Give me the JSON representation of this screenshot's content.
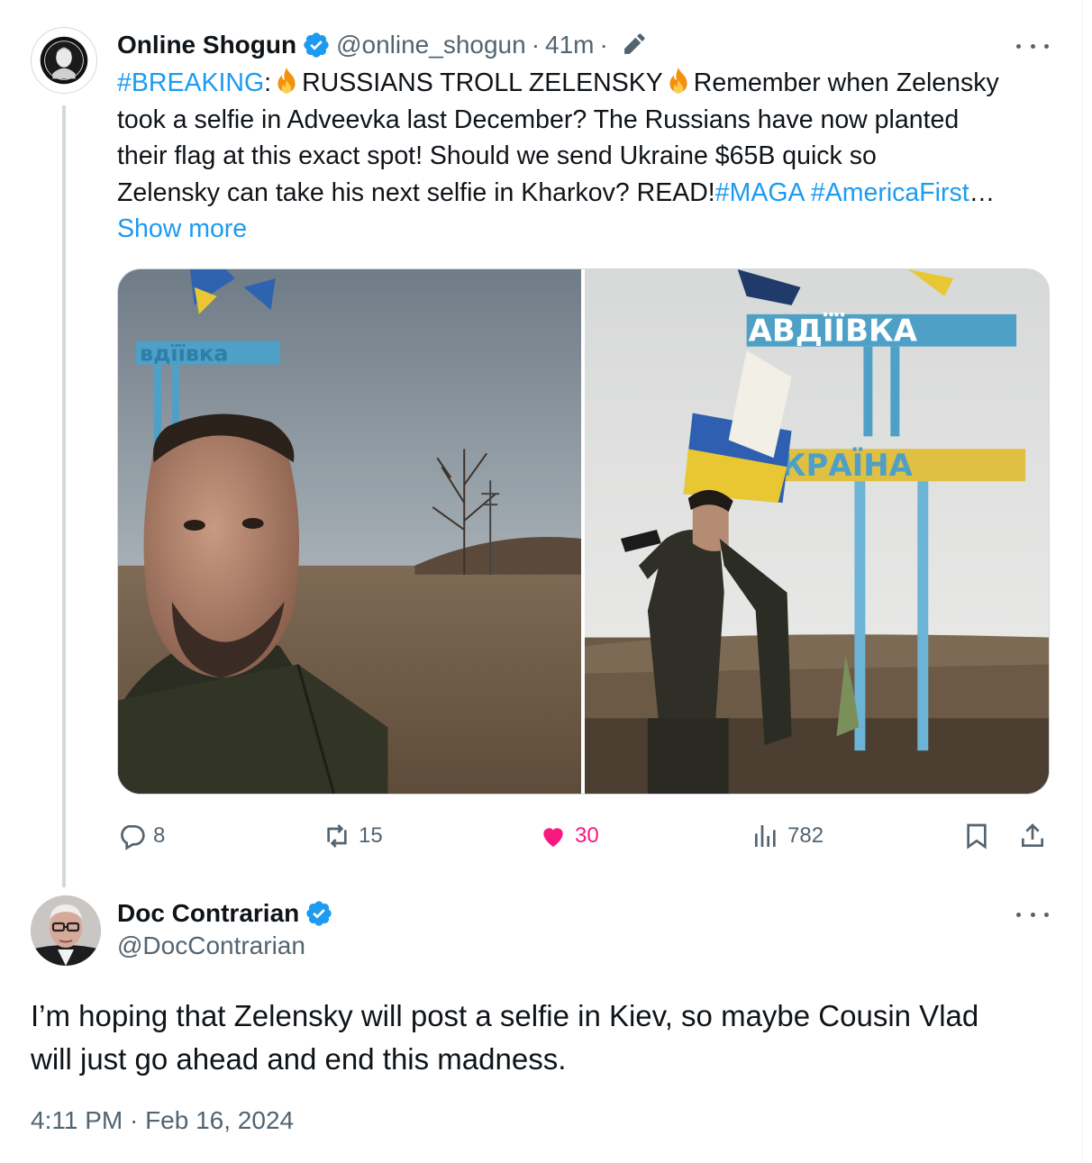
{
  "tweet1": {
    "name": "Online Shogun",
    "handle": "@online_shogun",
    "separator": "·",
    "time": "41m",
    "separator2": "·",
    "text_lines": [
      {
        "hashtag": "#BREAKING",
        "colon": ":",
        "part1": "RUSSIANS TROLL ZELENSKY",
        "part2": "Remember when Zelensky"
      },
      "took a selfie in Adveevka last December? The Russians have now planted",
      "their flag at this exact spot! Should we send Ukraine $65B quick so",
      {
        "plain": "Zelensky can take his next selfie in Kharkov? READ!",
        "tag1": "#MAGA",
        "tag2": "#AmericaFirst",
        "ellipsis": "…"
      }
    ],
    "show_more": "Show more",
    "image_left_sign_text": "вдїївка",
    "image_right_sign_top": "ABДЇЇBКA",
    "image_right_sign_bottom": "УКРАЇНА",
    "actions": {
      "replies": "8",
      "reposts": "15",
      "likes": "30",
      "views": "782"
    },
    "colors": {
      "accent": "#1d9bf0",
      "like": "#f91880",
      "muted": "#536471",
      "text": "#0f1419"
    }
  },
  "tweet2": {
    "name": "Doc Contrarian",
    "handle": "@DocContrarian",
    "text_lines": [
      "I’m hoping that Zelensky will post a selfie in Kiev, so maybe Cousin Vlad",
      "will just go ahead and end this madness."
    ],
    "timestamp": "4:11 PM · Feb 16, 2024"
  },
  "icons": [
    "verified-badge-icon",
    "edit-pencil-icon",
    "more-icon",
    "fire-emoji-icon",
    "reply-icon",
    "repost-icon",
    "like-heart-icon",
    "views-icon",
    "bookmark-icon",
    "share-icon"
  ]
}
